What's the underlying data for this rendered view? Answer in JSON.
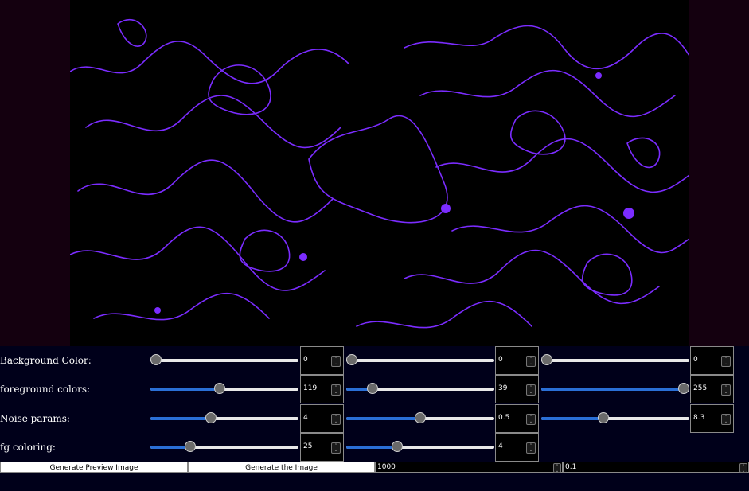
{
  "colors": {
    "page_bg": "#00001a",
    "canvas_bg": "#000000",
    "contour": "#7b2cff",
    "slider_fill": "#2a6fd6"
  },
  "preview": {
    "icon": "noise-contour-image"
  },
  "rows": [
    {
      "label": "Background Color:",
      "sliders": [
        {
          "value": "0",
          "min": 0,
          "max": 255
        },
        {
          "value": "0",
          "min": 0,
          "max": 255
        },
        {
          "value": "0",
          "min": 0,
          "max": 255
        }
      ]
    },
    {
      "label": "foreground colors:",
      "sliders": [
        {
          "value": "119",
          "min": 0,
          "max": 255
        },
        {
          "value": "39",
          "min": 0,
          "max": 255
        },
        {
          "value": "255",
          "min": 0,
          "max": 255
        }
      ]
    },
    {
      "label": "Noise params:",
      "sliders": [
        {
          "value": "4",
          "min": 0,
          "max": 10
        },
        {
          "value": "0.5",
          "min": 0,
          "max": 1
        },
        {
          "value": "8.3",
          "min": 0,
          "max": 20
        }
      ]
    },
    {
      "label": "fg coloring:",
      "sliders": [
        {
          "value": "25",
          "min": 0,
          "max": 100
        },
        {
          "value": "4",
          "min": 0,
          "max": 12
        }
      ]
    }
  ],
  "actions": {
    "preview_button": "Generate Preview Image",
    "generate_button": "Generate the Image",
    "size_value": "1000",
    "step_value": "0.1"
  }
}
